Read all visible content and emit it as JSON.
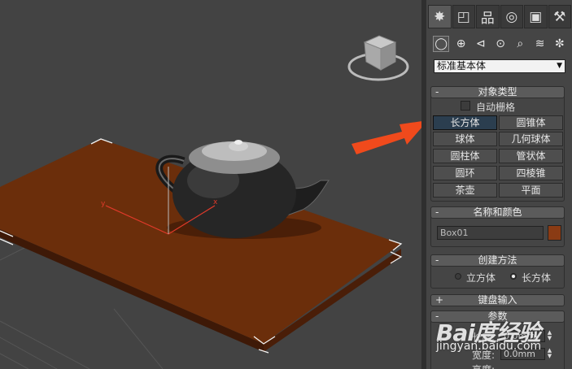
{
  "panel": {
    "tabs": [
      {
        "icon": "create-icon",
        "glyph": "✸"
      },
      {
        "icon": "modify-icon",
        "glyph": "◰"
      },
      {
        "icon": "hierarchy-icon",
        "glyph": "品"
      },
      {
        "icon": "motion-icon",
        "glyph": "◎"
      },
      {
        "icon": "display-icon",
        "glyph": "▣"
      },
      {
        "icon": "utilities-icon",
        "glyph": "⚒"
      }
    ],
    "subicons": [
      {
        "icon": "geometry-icon",
        "glyph": "◯"
      },
      {
        "icon": "shapes-icon",
        "glyph": "⊕"
      },
      {
        "icon": "lights-icon",
        "glyph": "⊲"
      },
      {
        "icon": "cameras-icon",
        "glyph": "⊙"
      },
      {
        "icon": "helpers-icon",
        "glyph": "⌕"
      },
      {
        "icon": "spacewarps-icon",
        "glyph": "≋"
      },
      {
        "icon": "systems-icon",
        "glyph": "✼"
      }
    ],
    "dropdown": {
      "value": "标准基本体"
    },
    "object_type": {
      "title": "对象类型",
      "sign": "-",
      "autogrid": "自动栅格",
      "buttons": [
        "长方体",
        "圆锥体",
        "球体",
        "几何球体",
        "圆柱体",
        "管状体",
        "圆环",
        "四棱锥",
        "茶壶",
        "平面"
      ]
    },
    "name_color": {
      "title": "名称和颜色",
      "sign": "-",
      "name": "Box01",
      "color": "#8a3b14"
    },
    "creation_method": {
      "title": "创建方法",
      "sign": "-",
      "option1": "立方体",
      "option2": "长方体",
      "selected": "长方体"
    },
    "keyboard_entry": {
      "title": "键盘输入",
      "sign": "+"
    },
    "parameters": {
      "title": "参数",
      "sign": "-",
      "length_label": "长度:",
      "length_value": "0.0mm",
      "width_label": "宽度:",
      "width_value": "0.0mm",
      "height_label": "高度:"
    }
  },
  "watermark": {
    "logo": "Bai度经验",
    "url": "jingyan.baidu.com"
  },
  "colors": {
    "viewport_bg": "#434343",
    "box_top": "#6b2e0b",
    "box_side": "#3e1907",
    "arrow": "#f04a1c"
  }
}
